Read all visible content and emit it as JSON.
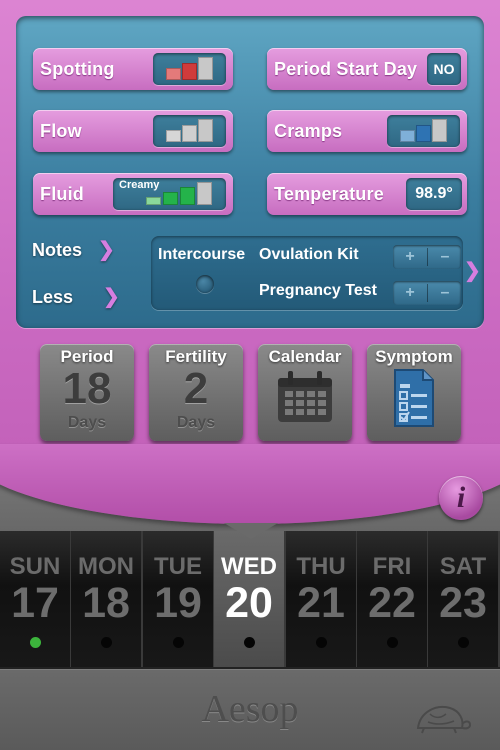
{
  "panel": {
    "spotting": {
      "label": "Spotting",
      "level": 2
    },
    "period_start_day": {
      "label": "Period Start Day",
      "value": "NO"
    },
    "flow": {
      "label": "Flow",
      "level": 0
    },
    "cramps": {
      "label": "Cramps",
      "level": 2
    },
    "fluid": {
      "label": "Fluid",
      "value": "Creamy",
      "level": 2
    },
    "temperature": {
      "label": "Temperature",
      "value": "98.9°"
    },
    "notes_link": "Notes",
    "less_link": "Less",
    "intercourse_label": "Intercourse",
    "ovulation_kit_label": "Ovulation Kit",
    "pregnancy_test_label": "Pregnancy Test",
    "plus_symbol": "+",
    "minus_symbol": "–"
  },
  "buttons": [
    {
      "title": "Period",
      "number": "18",
      "unit": "Days"
    },
    {
      "title": "Fertility",
      "number": "2",
      "unit": "Days"
    },
    {
      "title": "Calendar",
      "icon": "calendar-icon"
    },
    {
      "title": "Symptom",
      "icon": "symptom-document-icon"
    }
  ],
  "info_label": "i",
  "week": [
    {
      "name": "SUN",
      "date": "17",
      "dot": "green"
    },
    {
      "name": "MON",
      "date": "18",
      "dot": "black"
    },
    {
      "name": "TUE",
      "date": "19",
      "dot": "black"
    },
    {
      "name": "WED",
      "date": "20",
      "dot": "black",
      "selected": true
    },
    {
      "name": "THU",
      "date": "21",
      "dot": "black"
    },
    {
      "name": "FRI",
      "date": "22",
      "dot": "black"
    },
    {
      "name": "SAT",
      "date": "23",
      "dot": "black"
    }
  ],
  "brand": "Aesop",
  "colors": {
    "accent_pink": "#c96bc0",
    "panel_teal": "#3b7ea0",
    "bar_red": "#d03b3b",
    "bar_red_light": "#e47a7a",
    "bar_blue": "#2e73b3",
    "bar_blue_light": "#7fb0d8",
    "bar_green": "#24b34a",
    "bar_green_light": "#8ad89a",
    "bar_grey": "#c8c8c8",
    "dot_green": "#3cb43c"
  }
}
